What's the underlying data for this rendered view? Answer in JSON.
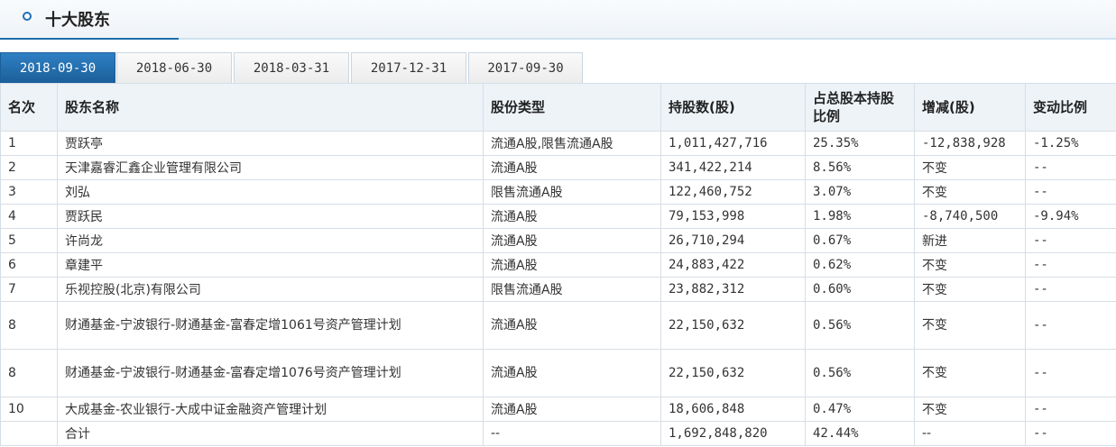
{
  "header": {
    "title": "十大股东"
  },
  "tabs": [
    "2018-09-30",
    "2018-06-30",
    "2018-03-31",
    "2017-12-31",
    "2017-09-30"
  ],
  "columns": [
    "名次",
    "股东名称",
    "股份类型",
    "持股数(股)",
    "占总股本持股比例",
    "增减(股)",
    "变动比例"
  ],
  "rows": [
    [
      "1",
      "贾跃亭",
      "流通A股,限售流通A股",
      "1,011,427,716",
      "25.35%",
      "-12,838,928",
      "-1.25%"
    ],
    [
      "2",
      "天津嘉睿汇鑫企业管理有限公司",
      "流通A股",
      "341,422,214",
      "8.56%",
      "不变",
      "--"
    ],
    [
      "3",
      "刘弘",
      "限售流通A股",
      "122,460,752",
      "3.07%",
      "不变",
      "--"
    ],
    [
      "4",
      "贾跃民",
      "流通A股",
      "79,153,998",
      "1.98%",
      "-8,740,500",
      "-9.94%"
    ],
    [
      "5",
      "许尚龙",
      "流通A股",
      "26,710,294",
      "0.67%",
      "新进",
      "--"
    ],
    [
      "6",
      "章建平",
      "流通A股",
      "24,883,422",
      "0.62%",
      "不变",
      "--"
    ],
    [
      "7",
      "乐视控股(北京)有限公司",
      "限售流通A股",
      "23,882,312",
      "0.60%",
      "不变",
      "--"
    ],
    [
      "8",
      "财通基金-宁波银行-财通基金-富春定增1061号资产管理计划",
      "流通A股",
      "22,150,632",
      "0.56%",
      "不变",
      "--"
    ],
    [
      "8",
      "财通基金-宁波银行-财通基金-富春定增1076号资产管理计划",
      "流通A股",
      "22,150,632",
      "0.56%",
      "不变",
      "--"
    ],
    [
      "10",
      "大成基金-农业银行-大成中证金融资产管理计划",
      "流通A股",
      "18,606,848",
      "0.47%",
      "不变",
      "--"
    ],
    [
      "",
      "合计",
      "--",
      "1,692,848,820",
      "42.44%",
      "--",
      "--"
    ]
  ]
}
